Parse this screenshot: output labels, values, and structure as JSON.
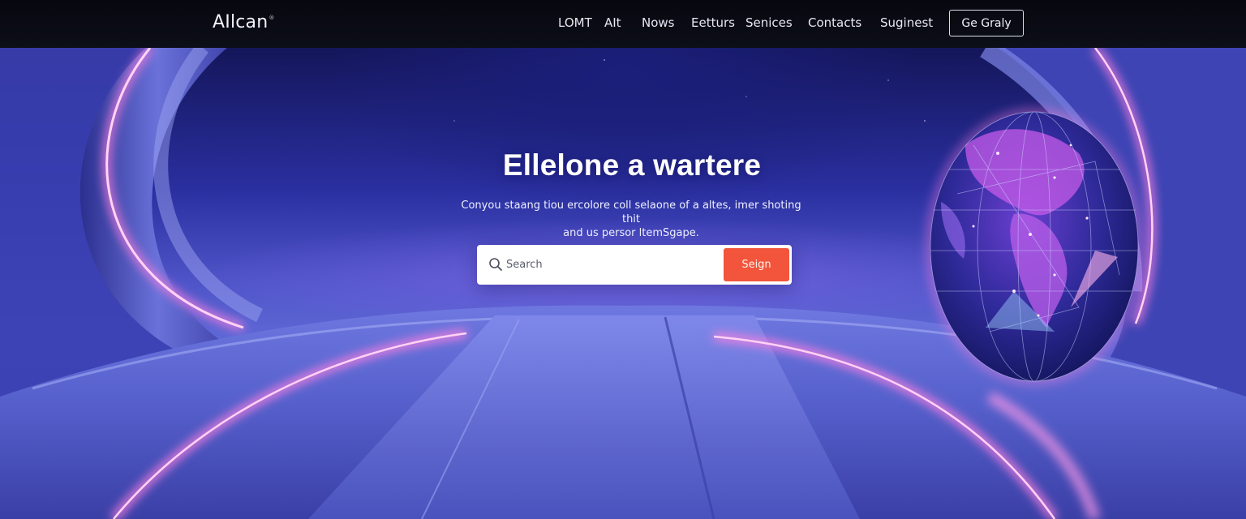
{
  "nav": {
    "brand": "AIlcan",
    "brand_mark": "®",
    "links": [
      "LOMT",
      "AIt",
      "Nows",
      "Eetturs",
      "Senices",
      "Contacts",
      "Suginest"
    ],
    "cta_label": "Ge Graly"
  },
  "hero": {
    "headline": "Ellelone a wartere",
    "subtitle_line1": "Conyou staang tiou ercolore coll selaone of a altes, imer shoting thit",
    "subtitle_line2": "and us persor ltemSgape.",
    "search": {
      "placeholder": "Search",
      "button_label": "Seign"
    }
  },
  "icons": [
    "search-icon",
    "globe-illustration"
  ],
  "colors": {
    "accent": "#f2553b",
    "nav_bg": "#0a0b14",
    "hero_blue": "#4f55c8",
    "glow_pink": "#ff6ad5"
  }
}
